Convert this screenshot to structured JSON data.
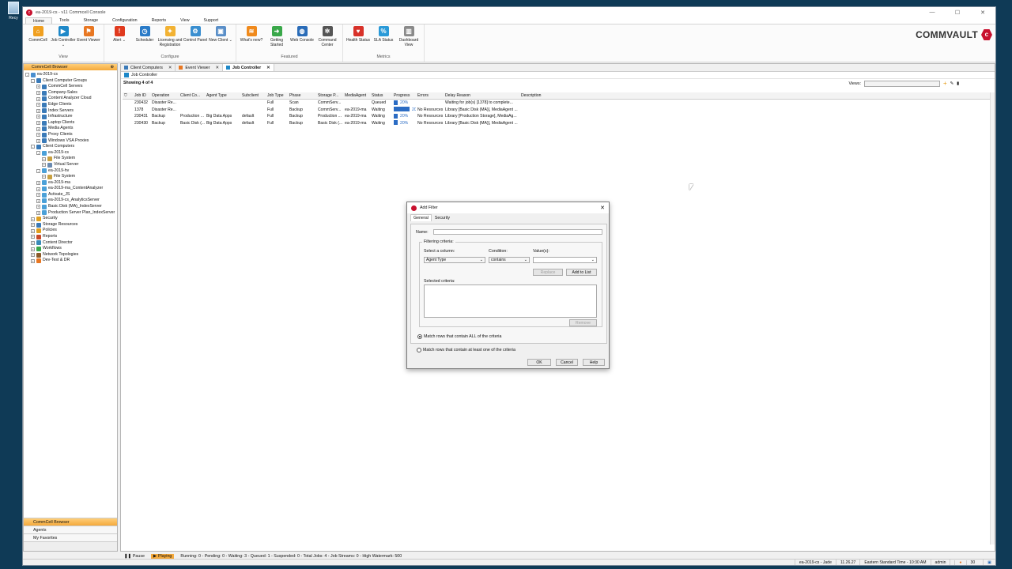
{
  "desktop": {
    "icon_label": "Recy"
  },
  "window": {
    "title": "ea-2019-cs - v11 Commcell Console",
    "controls": [
      "—",
      "☐",
      "✕"
    ]
  },
  "menu": [
    "Home",
    "Tools",
    "Storage",
    "Configuration",
    "Reports",
    "View",
    "Support"
  ],
  "ribbon": {
    "groups": [
      {
        "label": "View",
        "items": [
          {
            "label": "CommCell",
            "icon": "home-icon",
            "color": "#f0a020"
          },
          {
            "label": "Job Controller ⌄",
            "icon": "play-icon",
            "color": "#1e88c8"
          },
          {
            "label": "Event Viewer",
            "icon": "flag-icon",
            "color": "#e87722"
          }
        ]
      },
      {
        "label": "Configure",
        "items": [
          {
            "label": "Alert ⌄",
            "icon": "alert-icon",
            "color": "#e03a1e"
          },
          {
            "label": "Scheduler",
            "icon": "clock-icon",
            "color": "#2a7bc8"
          },
          {
            "label": "Licensing and Registration",
            "icon": "key-icon",
            "color": "#f2b233"
          },
          {
            "label": "Control Panel",
            "icon": "gear-icon",
            "color": "#3a8fd0"
          },
          {
            "label": "New Client ⌄",
            "icon": "client-icon",
            "color": "#5a8fc8"
          }
        ]
      },
      {
        "label": "Featured",
        "items": [
          {
            "label": "What's new?",
            "icon": "rss-icon",
            "color": "#f08a1c"
          },
          {
            "label": "Getting Started",
            "icon": "arrow-icon",
            "color": "#3aa84a"
          },
          {
            "label": "Web Console",
            "icon": "globe-icon",
            "color": "#2a6cb8"
          },
          {
            "label": "Command Center",
            "icon": "command-icon",
            "color": "#555555"
          }
        ]
      },
      {
        "label": "Metrics",
        "items": [
          {
            "label": "Health Status",
            "icon": "heart-icon",
            "color": "#d8322a"
          },
          {
            "label": "SLA Status",
            "icon": "sla-icon",
            "color": "#2a9ad8"
          },
          {
            "label": "Dashboard View",
            "icon": "dashboard-icon",
            "color": "#8a8a8a"
          }
        ]
      }
    ],
    "brand": "COMMVAULT"
  },
  "left_panel": {
    "header": "CommCell Browser",
    "tree": [
      {
        "label": "ea-2019-cs",
        "depth": 0,
        "exp": "-",
        "color": "#4a8fd0"
      },
      {
        "label": "Client Computer Groups",
        "depth": 1,
        "exp": "-",
        "color": "#3a7ab8"
      },
      {
        "label": "CommCell Servers",
        "depth": 2,
        "exp": "+",
        "color": "#3a7ab8"
      },
      {
        "label": "Company-Sales",
        "depth": 2,
        "exp": "+",
        "color": "#3a7ab8"
      },
      {
        "label": "Content Analyzer Cloud",
        "depth": 2,
        "exp": "+",
        "color": "#3a7ab8"
      },
      {
        "label": "Edge Clients",
        "depth": 2,
        "exp": "+",
        "color": "#3a7ab8"
      },
      {
        "label": "Index Servers",
        "depth": 2,
        "exp": "+",
        "color": "#3a7ab8"
      },
      {
        "label": "Infrastructure",
        "depth": 2,
        "exp": "+",
        "color": "#3a7ab8"
      },
      {
        "label": "Laptop Clients",
        "depth": 2,
        "exp": "+",
        "color": "#3a7ab8"
      },
      {
        "label": "Media Agents",
        "depth": 2,
        "exp": "+",
        "color": "#3a7ab8"
      },
      {
        "label": "Proxy Clients",
        "depth": 2,
        "exp": "+",
        "color": "#3a7ab8"
      },
      {
        "label": "Windows VSA Proxies",
        "depth": 2,
        "exp": "+",
        "color": "#3a7ab8"
      },
      {
        "label": "Client Computers",
        "depth": 1,
        "exp": "-",
        "color": "#3a7ab8"
      },
      {
        "label": "ea-2019-cs",
        "depth": 2,
        "exp": "-",
        "color": "#4aa0d8"
      },
      {
        "label": "File System",
        "depth": 3,
        "exp": "+",
        "color": "#c8a040"
      },
      {
        "label": "Virtual Server",
        "depth": 3,
        "exp": "+",
        "color": "#6a8ab0"
      },
      {
        "label": "ea-2019-hv",
        "depth": 2,
        "exp": "-",
        "color": "#4aa0d8"
      },
      {
        "label": "File System",
        "depth": 3,
        "exp": "+",
        "color": "#c8a040"
      },
      {
        "label": "ea-2019-ma",
        "depth": 2,
        "exp": "+",
        "color": "#4aa0d8"
      },
      {
        "label": "ea-2019-ma_ContentAnalyzer",
        "depth": 2,
        "exp": "+",
        "color": "#4aa0d8"
      },
      {
        "label": "Activate_JS",
        "depth": 2,
        "exp": "+",
        "color": "#4aa0d8"
      },
      {
        "label": "ea-2019-cs_AnalyticsServer",
        "depth": 2,
        "exp": "+",
        "color": "#4aa0d8"
      },
      {
        "label": "Basic Disk (MA)_IndexServer",
        "depth": 2,
        "exp": "+",
        "color": "#4aa0d8"
      },
      {
        "label": "Production Server Plan_IndexServer",
        "depth": 2,
        "exp": "+",
        "color": "#4aa0d8"
      },
      {
        "label": "Security",
        "depth": 1,
        "exp": "+",
        "color": "#e0a020"
      },
      {
        "label": "Storage Resources",
        "depth": 1,
        "exp": "+",
        "color": "#3a7ab8"
      },
      {
        "label": "Policies",
        "depth": 1,
        "exp": "+",
        "color": "#e0a020"
      },
      {
        "label": "Reports",
        "depth": 1,
        "exp": "+",
        "color": "#c84a2a"
      },
      {
        "label": "Content Director",
        "depth": 1,
        "exp": "+",
        "color": "#3a8ab8"
      },
      {
        "label": "Workflows",
        "depth": 1,
        "exp": "+",
        "color": "#3aa84a"
      },
      {
        "label": "Network Topologies",
        "depth": 1,
        "exp": "+",
        "color": "#8a5a2a"
      },
      {
        "label": "Dev-Test & DR",
        "depth": 1,
        "exp": "+",
        "color": "#e87722"
      }
    ],
    "bottom": [
      "CommCell Browser",
      "Agents",
      "My Favorites"
    ]
  },
  "tabs": [
    {
      "label": "Client Computers",
      "active": false
    },
    {
      "label": "Event Viewer",
      "active": false
    },
    {
      "label": "Job Controller",
      "active": true
    }
  ],
  "subheader": "Job Controller",
  "showing": "Showing 4 of 4",
  "views_label": "Views:",
  "grid": {
    "columns": [
      "Job ID",
      "Operation",
      "Client Co...",
      "Agent Type",
      "Subclient",
      "Job Type",
      "Phase",
      "Storage P...",
      "MediaAgent",
      "Status",
      "Progress",
      "Errors",
      "Delay Reason",
      "Description"
    ],
    "rows": [
      {
        "cells": [
          "230432",
          "Disaster Re...",
          "",
          "",
          "",
          "Full",
          "Scan",
          "CommServ...",
          "",
          "Queued"
        ],
        "progress": "20%",
        "errors": "",
        "delay": "Waiting for job(s) [1378] to complete...",
        "wide": false
      },
      {
        "cells": [
          "1378",
          "Disaster Re...",
          "",
          "",
          "",
          "Full",
          "Backup",
          "CommServ...",
          "ea-2019-ma",
          "Waiting"
        ],
        "progress": "20%",
        "errors": "No Resources",
        "delay": "Library [Basic Disk (MA)], MediaAgent ...",
        "wide": true
      },
      {
        "cells": [
          "230431",
          "Backup",
          "Production ...",
          "Big Data Apps",
          "default",
          "Full",
          "Backup",
          "Production ...",
          "ea-2019-ma",
          "Waiting"
        ],
        "progress": "20%",
        "errors": "No Resources",
        "delay": "Library [Production Storage], MediaAg...",
        "wide": false
      },
      {
        "cells": [
          "230430",
          "Backup",
          "Basic Disk (...",
          "Big Data Apps",
          "default",
          "Full",
          "Backup",
          "Basic Disk (...",
          "ea-2019-ma",
          "Waiting"
        ],
        "progress": "20%",
        "errors": "No Resources",
        "delay": "Library [Basic Disk (MA)], MediaAgent ...",
        "wide": false
      }
    ]
  },
  "statusbar": {
    "pause": "Pause",
    "playing": "Playing",
    "summary": "Running: 0 - Pending: 0 - Waiting: 3 - Queued: 1 - Suspended: 0 - Total Jobs: 4 - Job Streams: 0 - High Watermark: 500"
  },
  "bottombar": [
    "ea-2019-cs - Jade",
    "11.26.27",
    "Eastern Standard Time - 10:30 AM",
    "admin",
    "30"
  ],
  "dialog": {
    "title": "Add Filter",
    "tabs": [
      "General",
      "Security"
    ],
    "name_label": "Name:",
    "name_value": "",
    "filtering_legend": "Filtering criteria:",
    "column_label": "Select a column:",
    "column_value": "Agent Type",
    "condition_label": "Condition:",
    "condition_value": "contains",
    "values_label": "Value(s):",
    "values_value": "",
    "replace_btn": "Replace",
    "add_btn": "Add to List",
    "selected_label": "Selected criteria:",
    "remove_btn": "Remove",
    "match_all": "Match rows that contain ALL of the criteria",
    "match_any": "Match rows that contain at least one of the criteria",
    "ok": "OK",
    "cancel": "Cancel",
    "help": "Help"
  }
}
